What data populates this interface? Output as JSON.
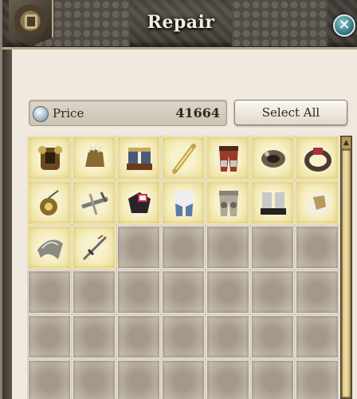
{
  "window": {
    "title": "Repair",
    "close_icon": "close-icon",
    "emblem_icon": "repair-emblem-icon"
  },
  "price": {
    "label": "Price",
    "value": "41664",
    "icon": "silver-coin-icon"
  },
  "select_all_label": "Select All",
  "colors": {
    "panel_bg": "#efe9df",
    "titlebar_bg": "#45413a",
    "item_slot_glow": "#efe4a4",
    "empty_slot": "#b4a999",
    "close_button": "#2d6e78",
    "scrollbar": "#d9c58a"
  },
  "inventory": {
    "columns": 7,
    "items": [
      {
        "name": "chest-armor",
        "color": "#6a4a1c"
      },
      {
        "name": "gauntlets",
        "color": "#8a6a30"
      },
      {
        "name": "boots",
        "color": "#4a5a7a"
      },
      {
        "name": "staff",
        "color": "#c8a24a"
      },
      {
        "name": "leather-pants",
        "color": "#9a3a2a"
      },
      {
        "name": "bracer",
        "color": "#6a5a4a"
      },
      {
        "name": "ring",
        "color": "#aa3040"
      },
      {
        "name": "amulet",
        "color": "#8a6a2a"
      },
      {
        "name": "crossbow",
        "color": "#7a7a7a"
      },
      {
        "name": "dark-bracer",
        "color": "#5a3a4a"
      },
      {
        "name": "cloth-leggings",
        "color": "#5a7aaa"
      },
      {
        "name": "plate-leggings",
        "color": "#b0a89a"
      },
      {
        "name": "white-boots",
        "color": "#c8c8c8"
      },
      {
        "name": "arm-guard",
        "color": "#b89a60"
      },
      {
        "name": "shoulder-armor",
        "color": "#8a8a80"
      },
      {
        "name": "dagger",
        "color": "#6a6a6a"
      }
    ],
    "empty_slot_count": 26
  }
}
